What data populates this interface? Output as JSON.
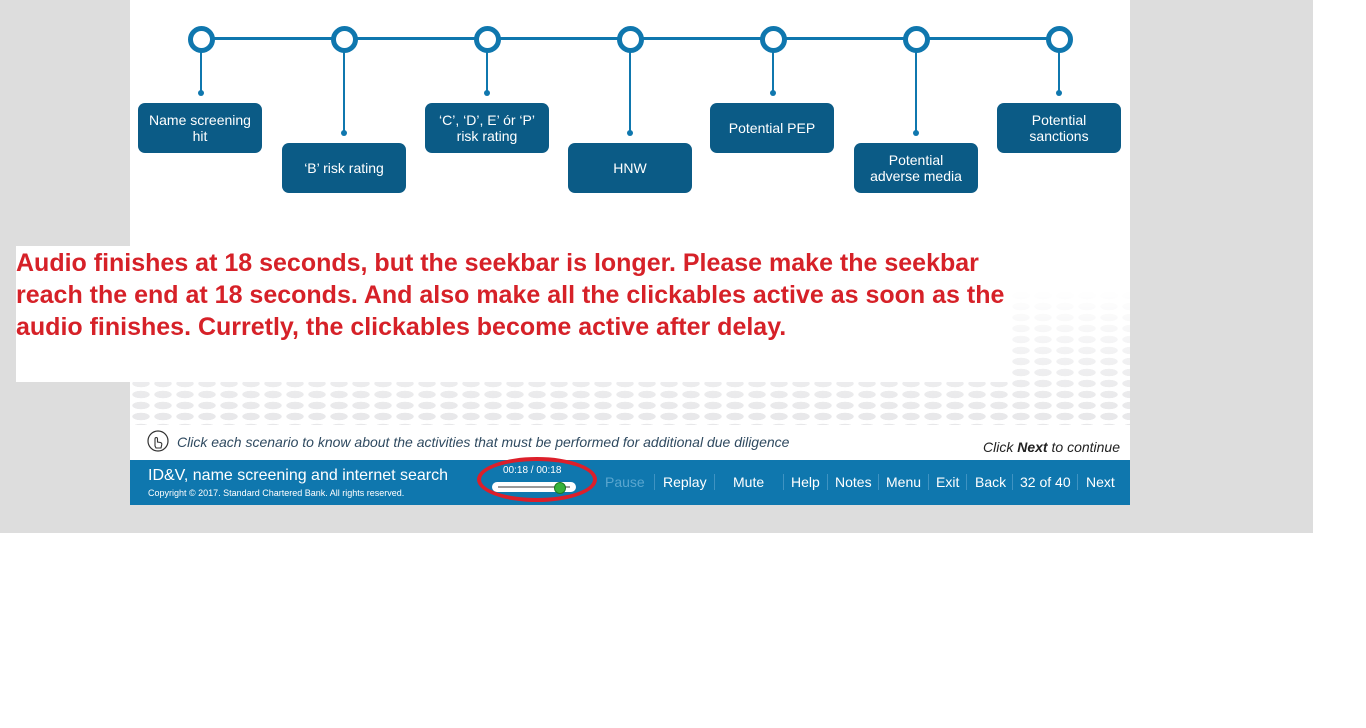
{
  "timeline": {
    "items": [
      {
        "label": "Name screening\nhit"
      },
      {
        "label": "‘B’ risk rating"
      },
      {
        "label": "‘C’, ‘D’, E’ ór ‘P’\nrisk rating"
      },
      {
        "label": "HNW"
      },
      {
        "label": "Potential PEP"
      },
      {
        "label": "Potential\nadverse media"
      },
      {
        "label": "Potential\nsanctions"
      }
    ]
  },
  "instruction": {
    "text": "Click each scenario to know about the activities that must be performed for additional due diligence",
    "icon": "hand-pointer-icon"
  },
  "continue": {
    "prefix": "Click ",
    "bold": "Next",
    "suffix": " to continue"
  },
  "player": {
    "course_title": "ID&V, name screening and internet search",
    "copyright": "Copyright © 2017. Standard Chartered Bank. All rights reserved.",
    "time": "00:18 / 00:18",
    "seek_progress": 0.85,
    "controls": {
      "pause": "Pause",
      "replay": "Replay",
      "mute": "Mute",
      "help": "Help",
      "notes": "Notes",
      "menu": "Menu",
      "exit": "Exit",
      "back": "Back",
      "page": "32 of 40",
      "next": "Next"
    }
  },
  "annotation": {
    "text": "Audio finishes at 18 seconds, but the seekbar is longer. Please make the seekbar reach the end at 18 seconds. And also make all the clickables active as soon as the audio finishes. Curretly, the clickables become active after delay."
  },
  "colors": {
    "brand_blue": "#0f77ae",
    "box_blue": "#0b5b86",
    "annotation_red": "#d62128",
    "seek_thumb": "#38b23a"
  }
}
